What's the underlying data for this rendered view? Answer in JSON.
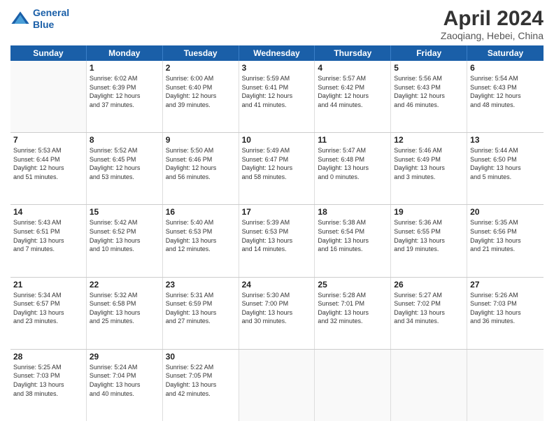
{
  "header": {
    "logo_line1": "General",
    "logo_line2": "Blue",
    "title": "April 2024",
    "subtitle": "Zaoqiang, Hebei, China"
  },
  "weekdays": [
    "Sunday",
    "Monday",
    "Tuesday",
    "Wednesday",
    "Thursday",
    "Friday",
    "Saturday"
  ],
  "weeks": [
    [
      {
        "day": "",
        "text": ""
      },
      {
        "day": "1",
        "text": "Sunrise: 6:02 AM\nSunset: 6:39 PM\nDaylight: 12 hours\nand 37 minutes."
      },
      {
        "day": "2",
        "text": "Sunrise: 6:00 AM\nSunset: 6:40 PM\nDaylight: 12 hours\nand 39 minutes."
      },
      {
        "day": "3",
        "text": "Sunrise: 5:59 AM\nSunset: 6:41 PM\nDaylight: 12 hours\nand 41 minutes."
      },
      {
        "day": "4",
        "text": "Sunrise: 5:57 AM\nSunset: 6:42 PM\nDaylight: 12 hours\nand 44 minutes."
      },
      {
        "day": "5",
        "text": "Sunrise: 5:56 AM\nSunset: 6:43 PM\nDaylight: 12 hours\nand 46 minutes."
      },
      {
        "day": "6",
        "text": "Sunrise: 5:54 AM\nSunset: 6:43 PM\nDaylight: 12 hours\nand 48 minutes."
      }
    ],
    [
      {
        "day": "7",
        "text": "Sunrise: 5:53 AM\nSunset: 6:44 PM\nDaylight: 12 hours\nand 51 minutes."
      },
      {
        "day": "8",
        "text": "Sunrise: 5:52 AM\nSunset: 6:45 PM\nDaylight: 12 hours\nand 53 minutes."
      },
      {
        "day": "9",
        "text": "Sunrise: 5:50 AM\nSunset: 6:46 PM\nDaylight: 12 hours\nand 56 minutes."
      },
      {
        "day": "10",
        "text": "Sunrise: 5:49 AM\nSunset: 6:47 PM\nDaylight: 12 hours\nand 58 minutes."
      },
      {
        "day": "11",
        "text": "Sunrise: 5:47 AM\nSunset: 6:48 PM\nDaylight: 13 hours\nand 0 minutes."
      },
      {
        "day": "12",
        "text": "Sunrise: 5:46 AM\nSunset: 6:49 PM\nDaylight: 13 hours\nand 3 minutes."
      },
      {
        "day": "13",
        "text": "Sunrise: 5:44 AM\nSunset: 6:50 PM\nDaylight: 13 hours\nand 5 minutes."
      }
    ],
    [
      {
        "day": "14",
        "text": "Sunrise: 5:43 AM\nSunset: 6:51 PM\nDaylight: 13 hours\nand 7 minutes."
      },
      {
        "day": "15",
        "text": "Sunrise: 5:42 AM\nSunset: 6:52 PM\nDaylight: 13 hours\nand 10 minutes."
      },
      {
        "day": "16",
        "text": "Sunrise: 5:40 AM\nSunset: 6:53 PM\nDaylight: 13 hours\nand 12 minutes."
      },
      {
        "day": "17",
        "text": "Sunrise: 5:39 AM\nSunset: 6:53 PM\nDaylight: 13 hours\nand 14 minutes."
      },
      {
        "day": "18",
        "text": "Sunrise: 5:38 AM\nSunset: 6:54 PM\nDaylight: 13 hours\nand 16 minutes."
      },
      {
        "day": "19",
        "text": "Sunrise: 5:36 AM\nSunset: 6:55 PM\nDaylight: 13 hours\nand 19 minutes."
      },
      {
        "day": "20",
        "text": "Sunrise: 5:35 AM\nSunset: 6:56 PM\nDaylight: 13 hours\nand 21 minutes."
      }
    ],
    [
      {
        "day": "21",
        "text": "Sunrise: 5:34 AM\nSunset: 6:57 PM\nDaylight: 13 hours\nand 23 minutes."
      },
      {
        "day": "22",
        "text": "Sunrise: 5:32 AM\nSunset: 6:58 PM\nDaylight: 13 hours\nand 25 minutes."
      },
      {
        "day": "23",
        "text": "Sunrise: 5:31 AM\nSunset: 6:59 PM\nDaylight: 13 hours\nand 27 minutes."
      },
      {
        "day": "24",
        "text": "Sunrise: 5:30 AM\nSunset: 7:00 PM\nDaylight: 13 hours\nand 30 minutes."
      },
      {
        "day": "25",
        "text": "Sunrise: 5:28 AM\nSunset: 7:01 PM\nDaylight: 13 hours\nand 32 minutes."
      },
      {
        "day": "26",
        "text": "Sunrise: 5:27 AM\nSunset: 7:02 PM\nDaylight: 13 hours\nand 34 minutes."
      },
      {
        "day": "27",
        "text": "Sunrise: 5:26 AM\nSunset: 7:03 PM\nDaylight: 13 hours\nand 36 minutes."
      }
    ],
    [
      {
        "day": "28",
        "text": "Sunrise: 5:25 AM\nSunset: 7:03 PM\nDaylight: 13 hours\nand 38 minutes."
      },
      {
        "day": "29",
        "text": "Sunrise: 5:24 AM\nSunset: 7:04 PM\nDaylight: 13 hours\nand 40 minutes."
      },
      {
        "day": "30",
        "text": "Sunrise: 5:22 AM\nSunset: 7:05 PM\nDaylight: 13 hours\nand 42 minutes."
      },
      {
        "day": "",
        "text": ""
      },
      {
        "day": "",
        "text": ""
      },
      {
        "day": "",
        "text": ""
      },
      {
        "day": "",
        "text": ""
      }
    ]
  ]
}
